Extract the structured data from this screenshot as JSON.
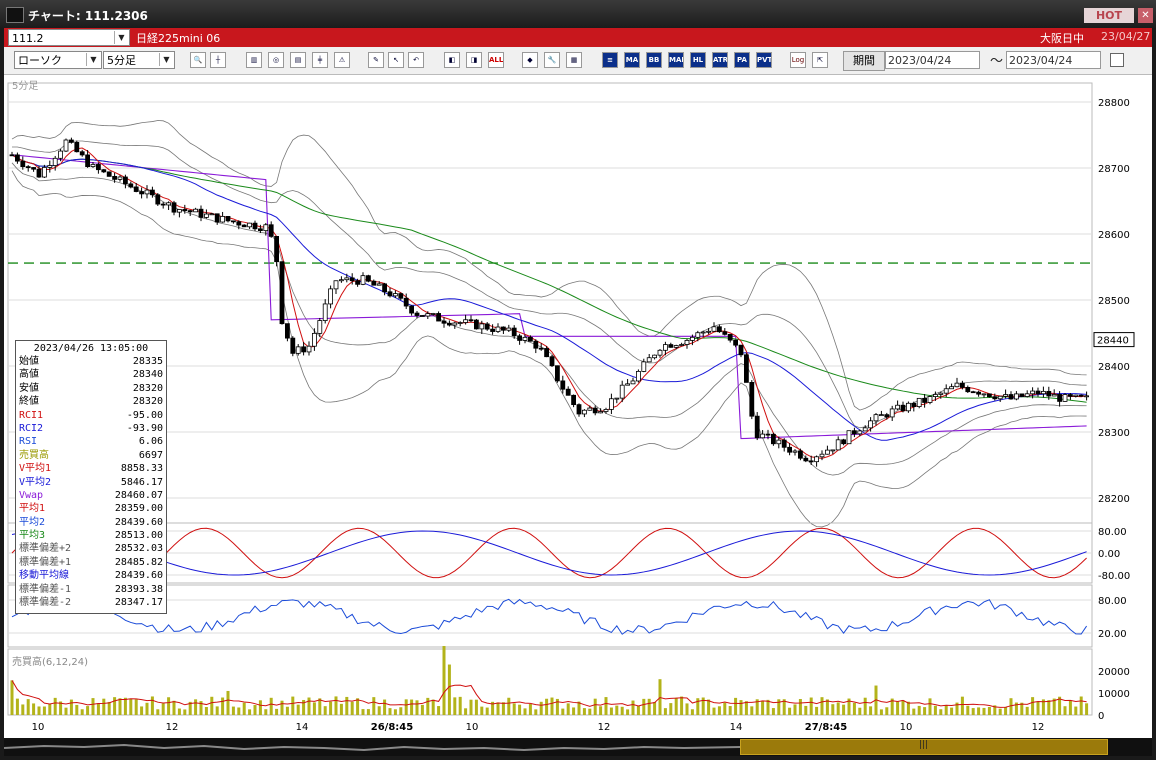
{
  "window": {
    "title": "チャート: 111.2306",
    "hot_label": "HOT",
    "close_symbol": "✕"
  },
  "row1": {
    "code": "111.2",
    "name": "日経225mini 06",
    "session": "大阪日中",
    "date": "23/04/27"
  },
  "toolbar": {
    "chart_type": "ローソク",
    "interval": "5分足",
    "icon_labels": {
      "mavg": "MA",
      "bb": "BB",
      "mae": "MAE",
      "hl": "HL",
      "atr": "ATR",
      "para": "PA RA",
      "pvt": "PVT",
      "log": "Log",
      "all": "ALL"
    },
    "period_label": "期間",
    "date_from": "2023/04/24",
    "date_to": "2023/04/24",
    "tilde": "〜"
  },
  "chart": {
    "interval_label": "5分足",
    "price_ticks": [
      "28800",
      "28700",
      "28600",
      "28500",
      "28400",
      "28300",
      "28200"
    ],
    "current_price": "28440",
    "osc_ticks": [
      "80.00",
      "0.00",
      "-80.00"
    ],
    "rsi_ticks": [
      "80.00",
      "20.00"
    ],
    "volume_label": "売買高(6,12,24)",
    "volume_ticks": [
      "20000",
      "10000",
      "0"
    ],
    "x_labels": [
      "10",
      "12",
      "14",
      "26/8:45",
      "10",
      "12",
      "14",
      "27/8:45",
      "10",
      "12"
    ],
    "colors": {
      "candle": "#000000",
      "ma1": "#d01010",
      "ma2": "#1a1ad8",
      "ma3": "#1a8a1a",
      "vwap": "#8a1ad8",
      "bb": "#777777",
      "hline": "#1a8a1a",
      "volume": "#b3b31a"
    }
  },
  "info": {
    "datetime": "2023/04/26  13:05:00",
    "rows": [
      {
        "key": "始値",
        "value": "28335",
        "color": "#000"
      },
      {
        "key": "高値",
        "value": "28340",
        "color": "#000"
      },
      {
        "key": "安値",
        "value": "28320",
        "color": "#000"
      },
      {
        "key": "終値",
        "value": "28320",
        "color": "#000"
      },
      {
        "key": "RCI1",
        "value": "-95.00",
        "color": "#d01010"
      },
      {
        "key": "RCI2",
        "value": "-93.90",
        "color": "#1a1ad8"
      },
      {
        "key": "RSI",
        "value": "6.06",
        "color": "#1a4bd8"
      },
      {
        "key": "売買高",
        "value": "6697",
        "color": "#999900"
      },
      {
        "key": "V平均1",
        "value": "8858.33",
        "color": "#d01010"
      },
      {
        "key": "V平均2",
        "value": "5846.17",
        "color": "#1a1ad8"
      },
      {
        "key": "Vwap",
        "value": "28460.07",
        "color": "#8a1ad8"
      },
      {
        "key": "平均1",
        "value": "28359.00",
        "color": "#d01010"
      },
      {
        "key": "平均2",
        "value": "28439.60",
        "color": "#1a4bd8"
      },
      {
        "key": "平均3",
        "value": "28513.00",
        "color": "#1a8a1a"
      },
      {
        "key": "標準偏差+2",
        "value": "28532.03",
        "color": "#555"
      },
      {
        "key": "標準偏差+1",
        "value": "28485.82",
        "color": "#555"
      },
      {
        "key": "移動平均線",
        "value": "28439.60",
        "color": "#1a1ad8"
      },
      {
        "key": "標準偏差-1",
        "value": "28393.38",
        "color": "#555"
      },
      {
        "key": "標準偏差-2",
        "value": "28347.17",
        "color": "#555"
      }
    ]
  }
}
